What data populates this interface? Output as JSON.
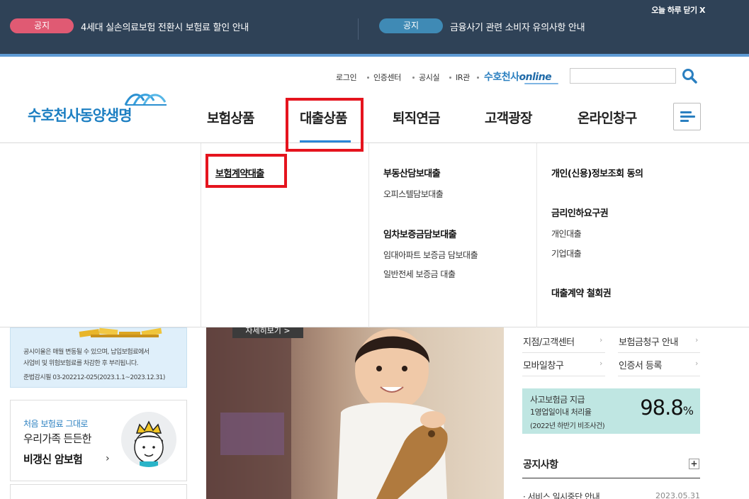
{
  "notice_bar": {
    "close_today": "오늘 하루 닫기 X",
    "items": [
      {
        "tag": "공지",
        "text": "4세대 실손의료보험 전환시 보험료 할인 안내"
      },
      {
        "tag": "공지",
        "text": "금융사기 관련 소비자 유의사항 안내"
      }
    ],
    "colors": {
      "bg": "#2f4257",
      "tag_red": "#e05a73",
      "tag_blue": "#3f8ab5"
    }
  },
  "util_links": [
    "로그인",
    "인증센터",
    "공시실",
    "IR관"
  ],
  "online_logo": {
    "main": "수호천사",
    "accent": "online"
  },
  "logo": "수호천사동양생명",
  "gnb": [
    "보험상품",
    "대출상품",
    "퇴직연금",
    "고객광장",
    "온라인창구"
  ],
  "mega_menu": {
    "col1": {
      "heading": "보험계약대출"
    },
    "col2": {
      "groups": [
        {
          "heading": "부동산담보대출",
          "items": [
            "오피스텔담보대출"
          ]
        },
        {
          "heading": "임차보증금담보대출",
          "items": [
            "임대아파트 보증금 담보대출",
            "일반전세 보증금 대출"
          ]
        }
      ]
    },
    "col3": {
      "groups": [
        {
          "heading": "개인(신용)정보조회 동의",
          "items": []
        },
        {
          "heading": "금리인하요구권",
          "items": [
            "개인대출",
            "기업대출"
          ]
        },
        {
          "heading": "대출계약 철회권",
          "items": []
        }
      ]
    }
  },
  "left_cards": {
    "rate_notice": [
      "공시이율은 매월 변동될 수 있으며, 납입보험료에서",
      "사업비 및 위험보험료를 차감한 후 부리됩니다.",
      "준법감시필 03-202212-025(2023.1.1~2023.12.31)"
    ],
    "promo": {
      "small": "처음 보험료 그대로",
      "mid": "우리가족 든든한",
      "big": "비갱신 암보험",
      "chevron": "›"
    }
  },
  "hero": {
    "more_button": "자세히보기 >"
  },
  "quick_links": [
    "지점/고객센터",
    "보험금청구 안내",
    "모바일창구",
    "인증서 등록"
  ],
  "claim_stat": {
    "line1": "사고보험금 지급",
    "line2": "1영업일이내 처리율",
    "line3": "(2022년 하반기 비조사건)",
    "value": "98.8",
    "unit": "%"
  },
  "notices": {
    "title": "공지사항",
    "plus": "+",
    "items": [
      {
        "text": "· 서비스 일시중단 안내",
        "date": "2023.05.31"
      }
    ]
  }
}
